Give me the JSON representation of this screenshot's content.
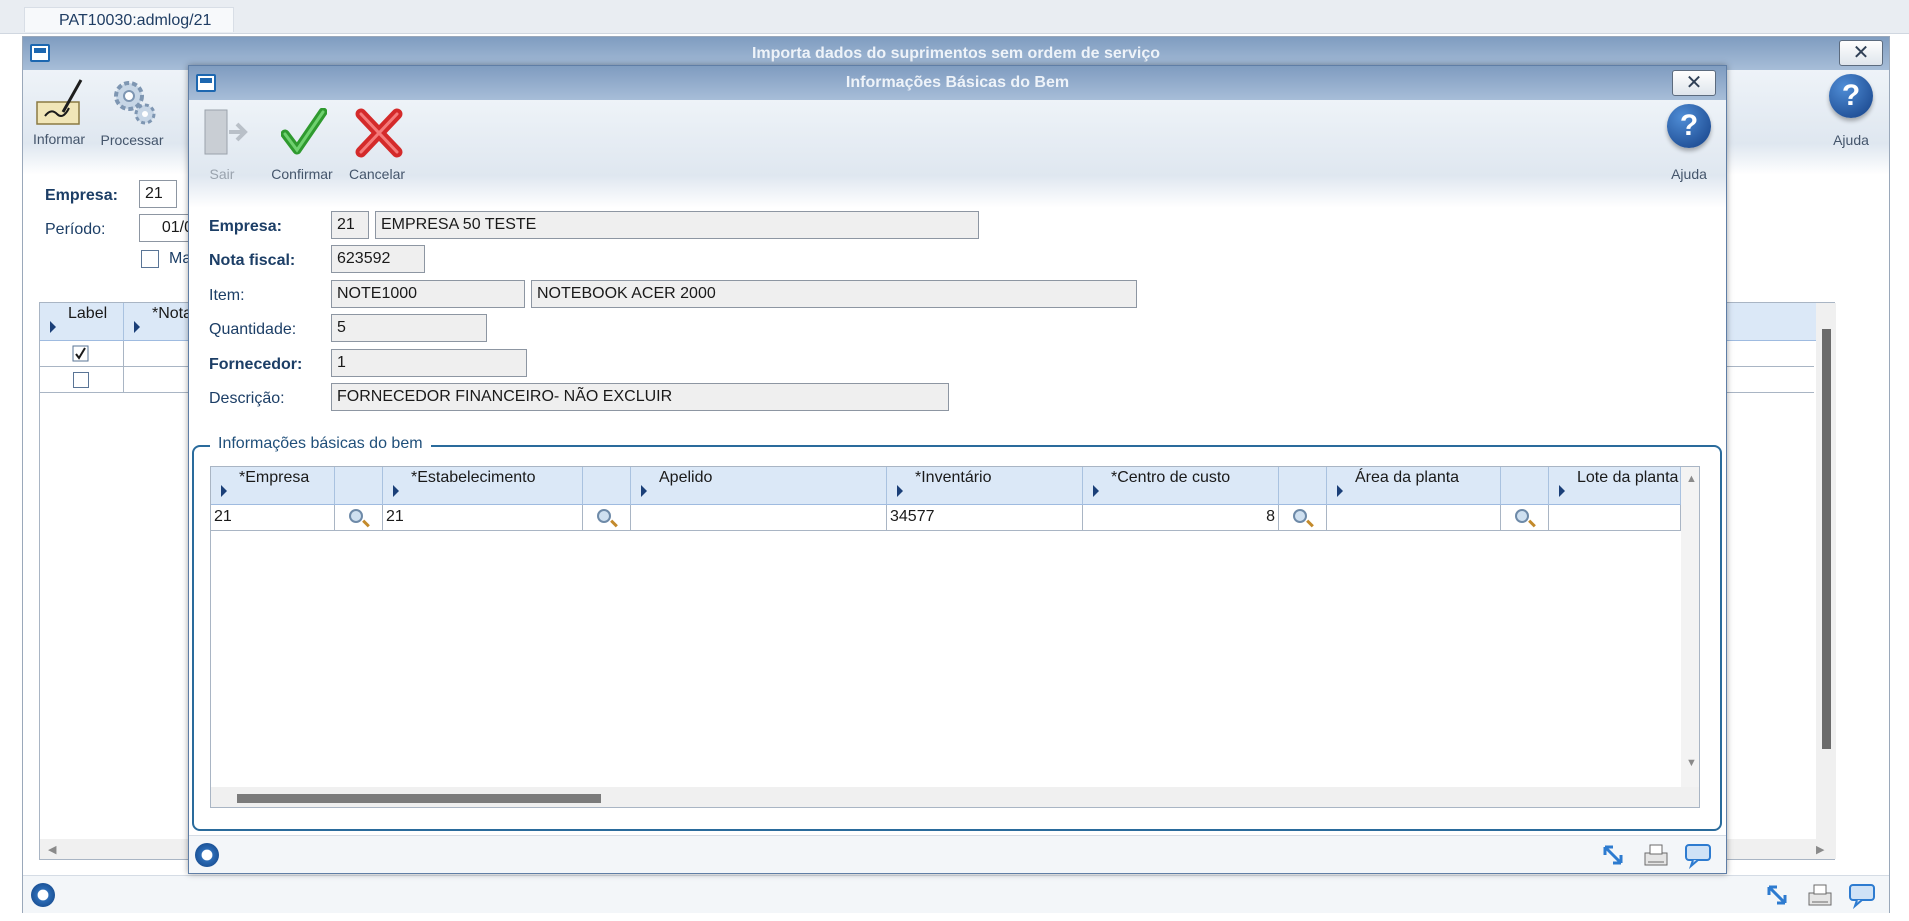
{
  "tab": {
    "label": "PAT10030:admlog/21"
  },
  "main": {
    "title": "Importa dados do suprimentos sem ordem de serviço",
    "toolbar": {
      "informar": "Informar",
      "processar": "Processar",
      "ajuda": "Ajuda"
    },
    "form": {
      "empresa_label": "Empresa:",
      "empresa_code": "21",
      "periodo_label": "Período:",
      "periodo_value": "01/0",
      "marcar_label": "Ma"
    },
    "grid": {
      "headers": [
        "Label",
        "*Nota"
      ],
      "rows": [
        {
          "checked": true
        },
        {
          "checked": false
        }
      ]
    }
  },
  "modal": {
    "title": "Informações Básicas do Bem",
    "toolbar": {
      "sair": "Sair",
      "confirmar": "Confirmar",
      "cancelar": "Cancelar",
      "ajuda": "Ajuda"
    },
    "form": {
      "empresa_label": "Empresa:",
      "empresa_code": "21",
      "empresa_name": "EMPRESA 50 TESTE",
      "nota_label": "Nota fiscal:",
      "nota_value": "623592",
      "item_label": "Item:",
      "item_code": "NOTE1000",
      "item_desc": "NOTEBOOK ACER 2000",
      "quantidade_label": "Quantidade:",
      "quantidade_value": "5",
      "fornecedor_label": "Fornecedor:",
      "fornecedor_value": "1",
      "descricao_label": "Descrição:",
      "descricao_value": "FORNECEDOR FINANCEIRO- NÃO EXCLUIR"
    },
    "group": {
      "title": "Informações básicas do bem",
      "headers": [
        "*Empresa",
        "",
        "*Estabelecimento",
        "",
        "Apelido",
        "*Inventário",
        "*Centro de custo",
        "",
        "Área da planta",
        "",
        "Lote da planta"
      ],
      "row": {
        "empresa": "21",
        "estabelecimento": "21",
        "apelido": "",
        "inventario": "34577",
        "centro_custo": "8",
        "area_planta": "",
        "lote_planta": ""
      }
    }
  },
  "colors": {
    "title_bar": "#8fa9cc",
    "group_border": "#2a6b9c",
    "grid_header": "#dbe8f7"
  }
}
